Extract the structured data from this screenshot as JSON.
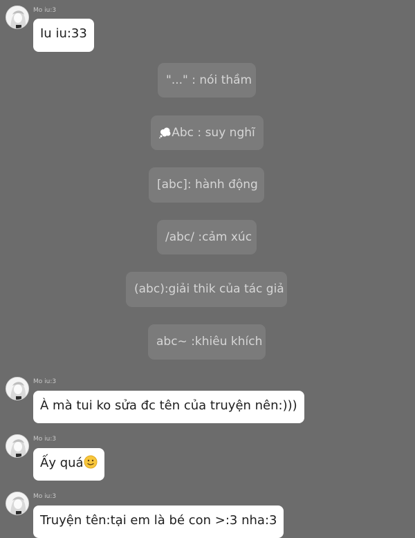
{
  "messages": [
    {
      "sender": "Mo iu:3",
      "text": "Iu iu:33"
    },
    {
      "sender": "Mo iu:3",
      "text": "À mà tui ko sửa đc tên của truyện nên:)))"
    },
    {
      "sender": "Mo iu:3",
      "text": "Ấy quá",
      "emoji": "slightly-smiling-face"
    },
    {
      "sender": "Mo iu:3",
      "text": "Truyện tên:tại em là bé con >:3 nha:3"
    }
  ],
  "narration": [
    {
      "text": "\"...\" : nói thầm"
    },
    {
      "text": "Abc : suy nghĩ",
      "icon": "thought-bubble-icon"
    },
    {
      "text": "[abc]: hành động"
    },
    {
      "text": "/abc/ :cảm xúc"
    },
    {
      "text": "(abc):giải thik của tác giả"
    },
    {
      "text": "abc~ :khiêu khích"
    }
  ],
  "colors": {
    "background": "#6c6c6c",
    "bubble": "#ffffff",
    "narration_bg": "#7b7b7b",
    "narration_text": "#d6d6d6"
  }
}
